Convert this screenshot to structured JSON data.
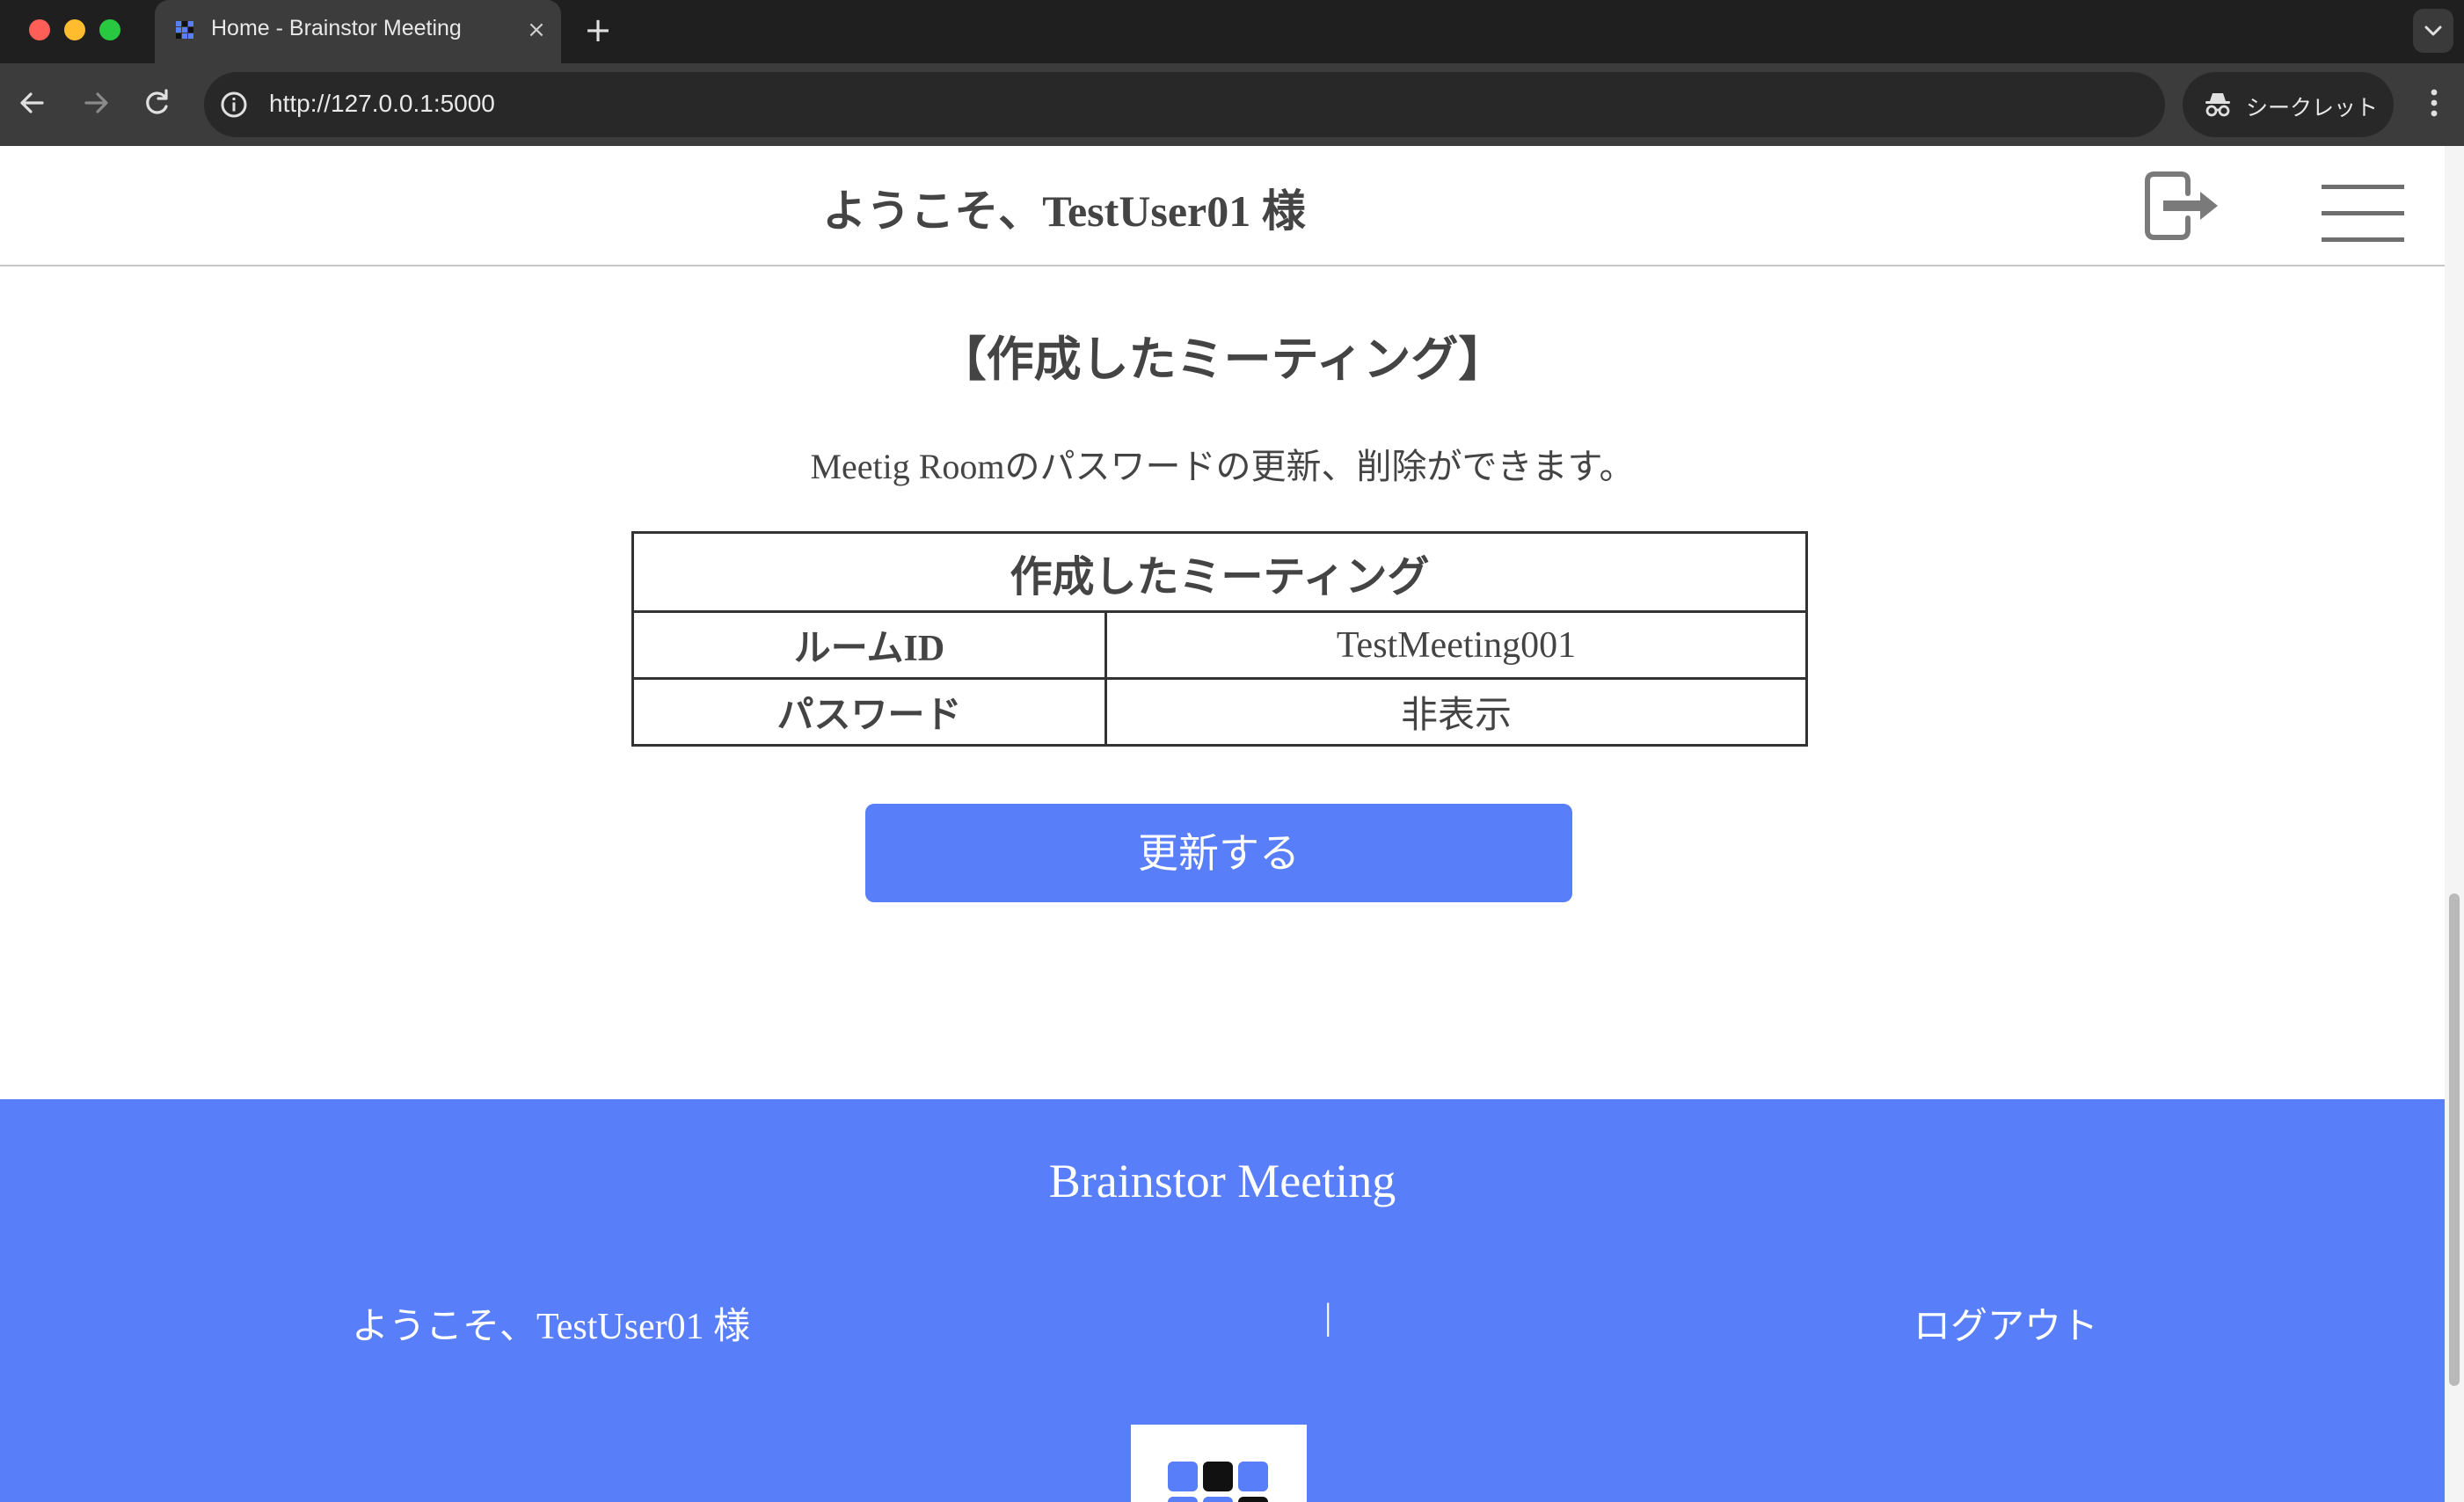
{
  "browser": {
    "tab_title": "Home - Brainstor Meeting",
    "tab_close": "×",
    "new_tab": "+",
    "url": "http://127.0.0.1:5000",
    "incognito_label": "シークレット"
  },
  "header": {
    "welcome": "ようこそ、TestUser01 様"
  },
  "section": {
    "title": "【作成したミーティング】",
    "description": "Meetig Roomのパスワードの更新、削除ができます。"
  },
  "table": {
    "caption": "作成したミーティング",
    "rows": [
      {
        "key": "ルームID",
        "value": "TestMeeting001"
      },
      {
        "key": "パスワード",
        "value": "非表示"
      }
    ]
  },
  "update_button": "更新する",
  "footer": {
    "brand": "Brainstor Meeting",
    "welcome": "ようこそ、TestUser01 様",
    "separator": "|",
    "logout": "ログアウト"
  },
  "colors": {
    "accent": "#587ef9",
    "text": "#444444"
  }
}
